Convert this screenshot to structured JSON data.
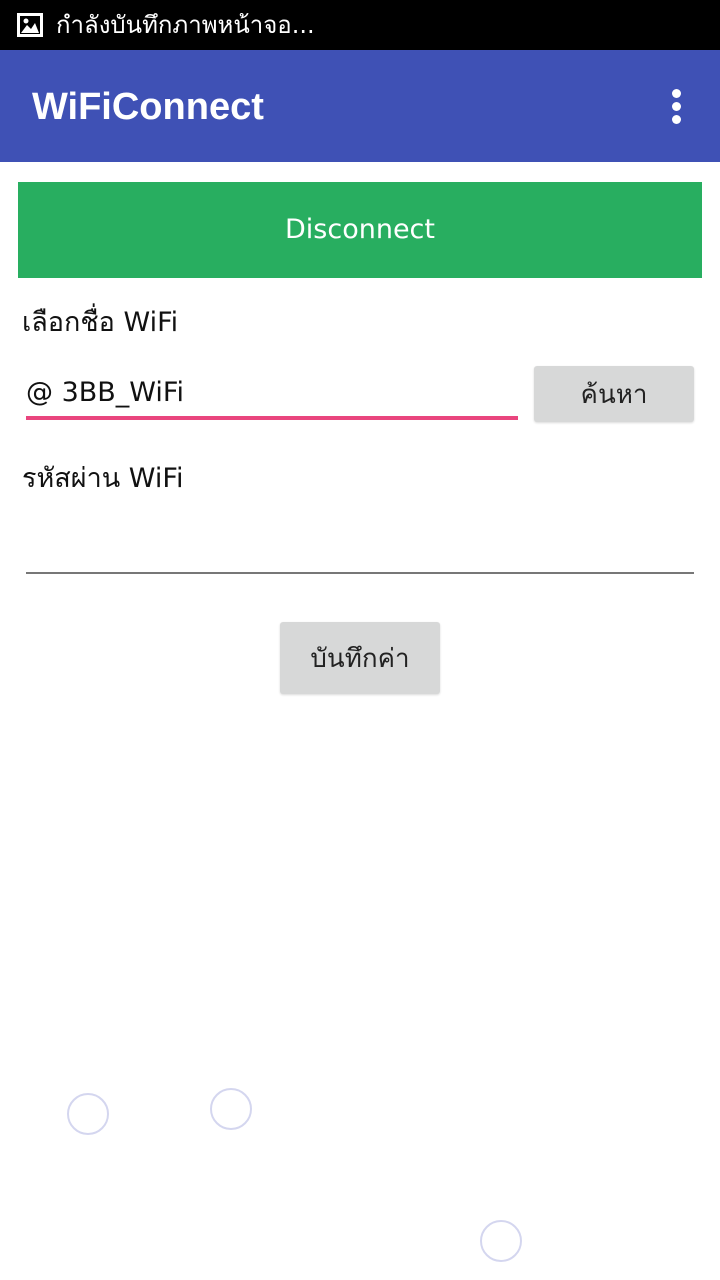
{
  "status_bar": {
    "icon": "image-icon",
    "text": "กำลังบันทึกภาพหน้าจอ..."
  },
  "app_bar": {
    "title": "WiFiConnect",
    "menu_icon": "more-vert-icon"
  },
  "main": {
    "disconnect_label": "Disconnect",
    "ssid_label": "เลือกชื่อ WiFi",
    "ssid_value": "@ 3BB_WiFi",
    "search_label": "ค้นหา",
    "password_label": "รหัสผ่าน WiFi",
    "password_value": "",
    "save_label": "บันทึกค่า"
  },
  "colors": {
    "app_bar": "#3f51b5",
    "disconnect": "#28ae60",
    "focus_underline": "#e9457e",
    "button_gray": "#d7d8d8"
  }
}
